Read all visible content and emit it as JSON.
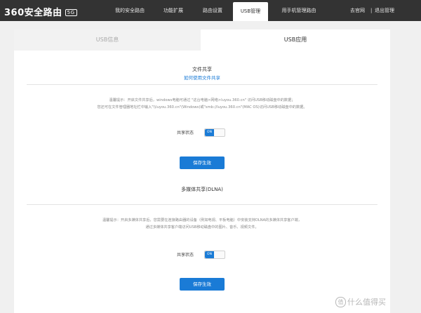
{
  "header": {
    "logo_text": "360安全路由",
    "logo_badge": "5G",
    "nav": [
      {
        "label": "我的安全路由"
      },
      {
        "label": "功能扩展"
      },
      {
        "label": "路由设置"
      },
      {
        "label": "USB管理",
        "active": true
      },
      {
        "label": "用手机管理路由"
      }
    ],
    "links": {
      "official": "去官网",
      "separator": "|",
      "logout": "退出管理"
    }
  },
  "tabs": [
    {
      "label": "USB信息",
      "active": false
    },
    {
      "label": "USB应用",
      "active": true
    }
  ],
  "file_share": {
    "title": "文件共享",
    "help_link": "如何使用文件共享",
    "tip_line1": "温馨提示：开启文件共享后，windows电脑可通过 \"这台电脑>网络>luyou.360.cn\" 访问USB移动磁盘中的数据；",
    "tip_line2": "您还可在文件管理器地址栏中输入\"\\\\luyou.360.cn\"(Windows)或\"smb://luyou.360.cn\"(MAC OS)访问USB移动磁盘中的数据。",
    "share_status_label": "共享状态",
    "toggle_text": "ON",
    "save_label": "保存生效"
  },
  "dlna": {
    "title": "多媒体共享(DLNA)",
    "tip_line1": "温馨提示：开启多媒体共享后，您需要在连接路由器的设备（例如电视、平板电脑）中安装支持DLNA的多媒体共享客户端，",
    "tip_line2": "通过多媒体共享客户端访问USB移动磁盘中的图片、音乐、视频文件。",
    "share_status_label": "共享状态",
    "toggle_text": "ON",
    "save_label": "保存生效"
  },
  "watermark": {
    "badge": "值",
    "text": "什么值得买"
  },
  "colors": {
    "topbar": "#333333",
    "accent": "#1a7bd6",
    "page_bg": "#f0f0f0"
  }
}
